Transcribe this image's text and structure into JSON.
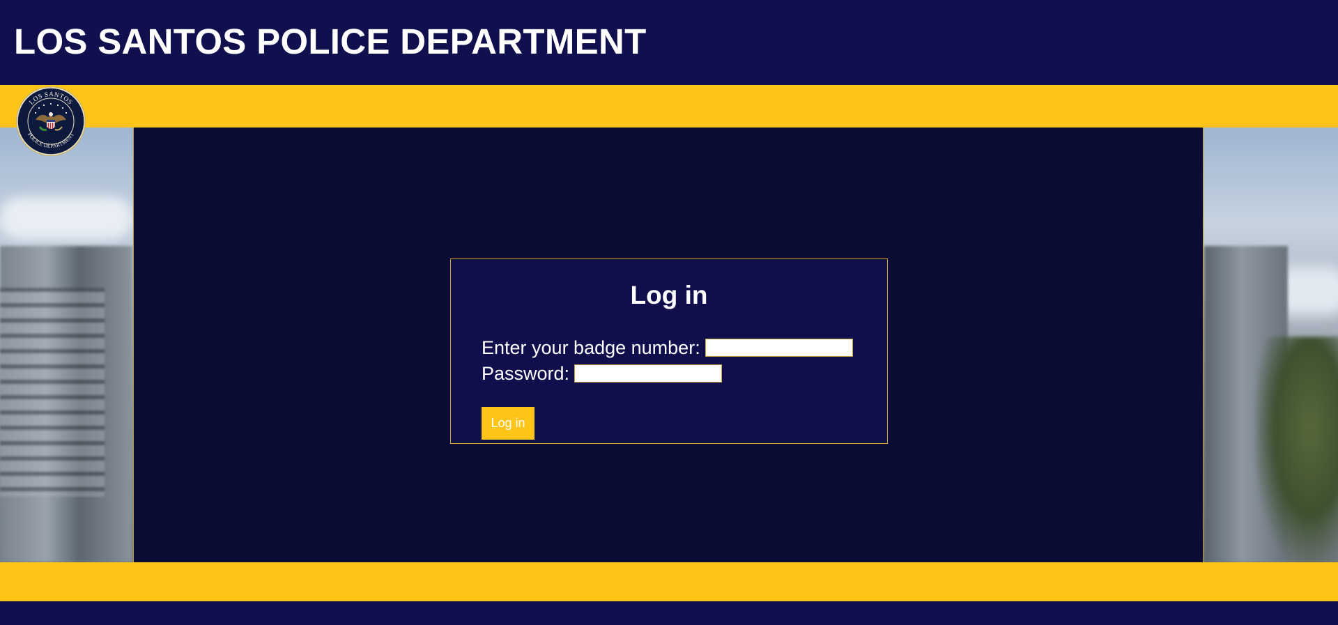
{
  "header": {
    "title": "LOS SANTOS POLICE DEPARTMENT"
  },
  "logo": {
    "top_text": "LOS SANTOS",
    "bottom_text": "POLICE DEPARTMENT",
    "icon": "eagle-seal-icon"
  },
  "login": {
    "title": "Log in",
    "badge_label": "Enter your badge number:",
    "badge_value": "",
    "password_label": "Password:",
    "password_value": "",
    "button_label": "Log in"
  },
  "colors": {
    "navy": "#10104f",
    "panel": "#0b0c34",
    "gold": "#fdc518",
    "white": "#ffffff"
  }
}
